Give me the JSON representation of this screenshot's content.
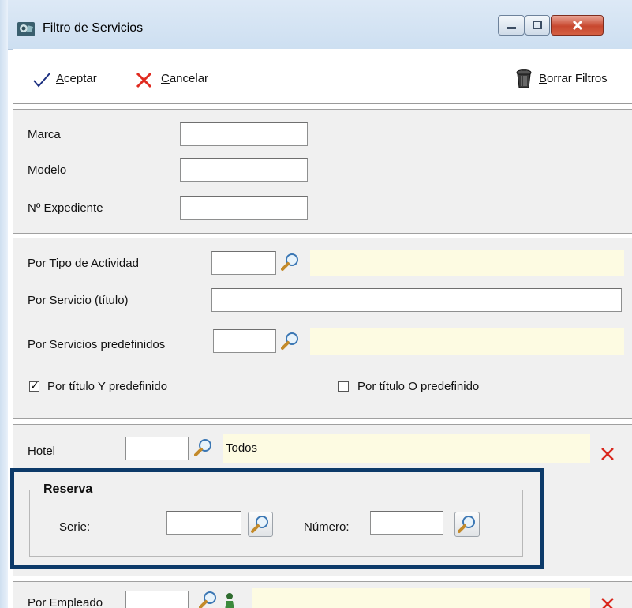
{
  "window": {
    "title": "Filtro de Servicios"
  },
  "toolbar": {
    "accept_access": "A",
    "accept_rest": "ceptar",
    "cancel_access": "C",
    "cancel_rest": "ancelar",
    "clear_access": "B",
    "clear_rest": "orrar Filtros"
  },
  "vehicle": {
    "brand_label": "Marca",
    "brand_value": "",
    "model_label": "Modelo",
    "model_value": "",
    "file_label": "Nº Expediente",
    "file_value": ""
  },
  "activity": {
    "type_label": "Por Tipo de Actividad",
    "type_code": "",
    "type_desc": "",
    "title_label": "Por Servicio (título)",
    "title_value": "",
    "predef_label": "Por Servicios predefinidos",
    "predef_code": "",
    "predef_desc": "",
    "and_label": "Por título Y predefinido",
    "and_checked": true,
    "or_label": "Por título O predefinido",
    "or_checked": false
  },
  "hotel": {
    "label": "Hotel",
    "code": "",
    "desc": "Todos"
  },
  "reserva": {
    "title": "Reserva",
    "serie_label": "Serie:",
    "serie_value": "",
    "numero_label": "Número:",
    "numero_value": ""
  },
  "employee": {
    "label": "Por Empleado",
    "code": "",
    "desc": ""
  },
  "icons": {
    "app": "app-window-icon",
    "accept": "checkmark-icon",
    "cancel": "red-x-icon",
    "clear": "trash-can-icon",
    "lookup": "magnifier-icon",
    "person": "person-icon",
    "clear_field": "red-x-icon"
  },
  "colors": {
    "lookup_field": "#fdfbe2",
    "highlight_border": "#0c3a69",
    "clear_x": "#d9261c"
  }
}
